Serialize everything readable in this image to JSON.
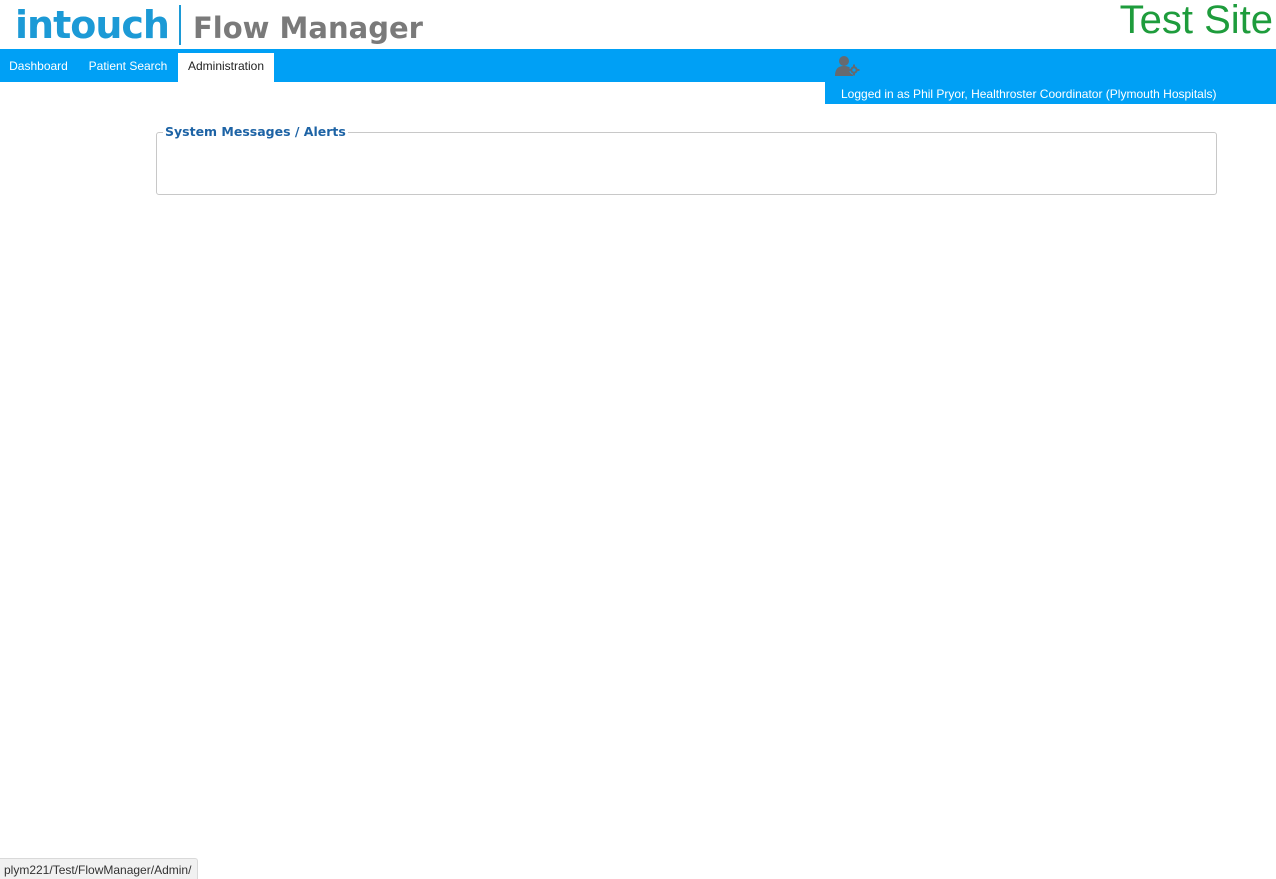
{
  "header": {
    "brand": "intouch",
    "product": "Flow Manager",
    "site_label": "Test Site"
  },
  "nav": {
    "tabs": [
      {
        "label": "Dashboard",
        "active": false
      },
      {
        "label": "Patient Search",
        "active": false
      },
      {
        "label": "Administration",
        "active": true
      }
    ]
  },
  "user": {
    "icon": "user-settings-icon",
    "logged_in_text": "Logged in as Phil Pryor, Healthroster Coordinator (Plymouth Hospitals)"
  },
  "main": {
    "alerts_title": "System Messages / Alerts"
  },
  "status_bar": {
    "url": "plym221/Test/FlowManager/Admin/"
  },
  "colors": {
    "nav_blue": "#00a0f5",
    "brand_blue": "#1c9ad6",
    "site_green": "#1e9c3c",
    "legend_blue": "#1d63a5"
  }
}
